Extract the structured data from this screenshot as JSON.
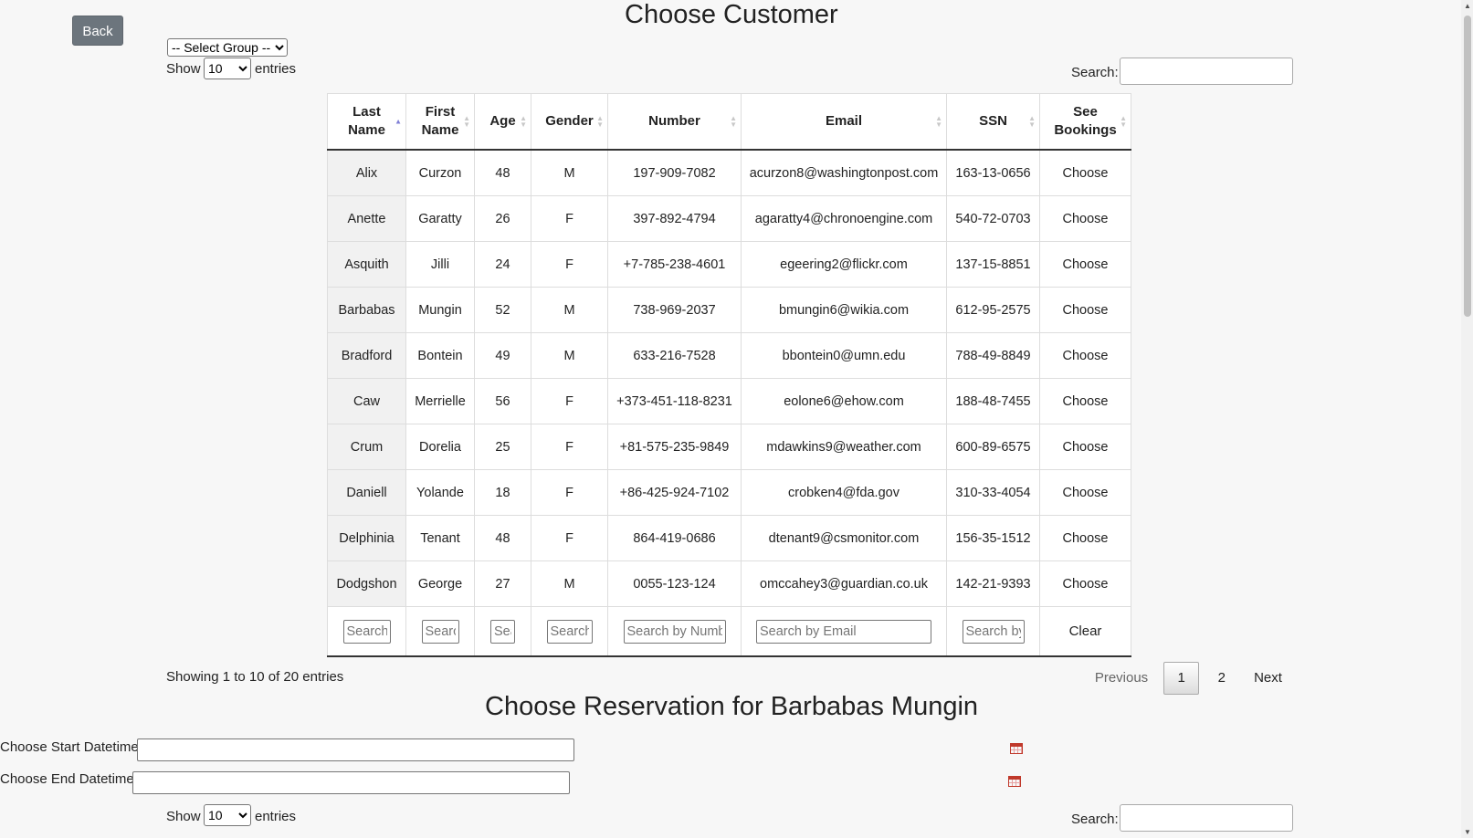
{
  "back_label": "Back",
  "customer_section": {
    "title": "Choose Customer",
    "group_select": "-- Select Group --",
    "show_label": "Show",
    "entries_value": "10",
    "entries_label": "entries",
    "search_label": "Search:"
  },
  "table": {
    "columns": [
      "Last Name",
      "First Name",
      "Age",
      "Gender",
      "Number",
      "Email",
      "SSN",
      "See Bookings"
    ],
    "rows": [
      [
        "Alix",
        "Curzon",
        "48",
        "M",
        "197-909-7082",
        "acurzon8@washingtonpost.com",
        "163-13-0656",
        "Choose"
      ],
      [
        "Anette",
        "Garatty",
        "26",
        "F",
        "397-892-4794",
        "agaratty4@chronoengine.com",
        "540-72-0703",
        "Choose"
      ],
      [
        "Asquith",
        "Jilli",
        "24",
        "F",
        "+7-785-238-4601",
        "egeering2@flickr.com",
        "137-15-8851",
        "Choose"
      ],
      [
        "Barbabas",
        "Mungin",
        "52",
        "M",
        "738-969-2037",
        "bmungin6@wikia.com",
        "612-95-2575",
        "Choose"
      ],
      [
        "Bradford",
        "Bontein",
        "49",
        "M",
        "633-216-7528",
        "bbontein0@umn.edu",
        "788-49-8849",
        "Choose"
      ],
      [
        "Caw",
        "Merrielle",
        "56",
        "F",
        "+373-451-118-8231",
        "eolone6@ehow.com",
        "188-48-7455",
        "Choose"
      ],
      [
        "Crum",
        "Dorelia",
        "25",
        "F",
        "+81-575-235-9849",
        "mdawkins9@weather.com",
        "600-89-6575",
        "Choose"
      ],
      [
        "Daniell",
        "Yolande",
        "18",
        "F",
        "+86-425-924-7102",
        "crobken4@fda.gov",
        "310-33-4054",
        "Choose"
      ],
      [
        "Delphinia",
        "Tenant",
        "48",
        "F",
        "864-419-0686",
        "dtenant9@csmonitor.com",
        "156-35-1512",
        "Choose"
      ],
      [
        "Dodgshon",
        "George",
        "27",
        "M",
        "0055-123-124",
        "omccahey3@guardian.co.uk",
        "142-21-9393",
        "Choose"
      ]
    ],
    "footer_placeholders": [
      "Search by Last Name",
      "Search by First Name",
      "Search by Age",
      "Search by Gender",
      "Search by Number",
      "Search by Email",
      "Search by SSN"
    ],
    "clear_label": "Clear"
  },
  "info": "Showing 1 to 10 of 20 entries",
  "pagination": {
    "previous": "Previous",
    "pages": [
      "1",
      "2"
    ],
    "current": "1",
    "next": "Next"
  },
  "reservation_section": {
    "title": "Choose Reservation for Barbabas Mungin",
    "start_label": "Choose Start Datetime:",
    "end_label": "Choose End Datetime:",
    "show_label": "Show",
    "entries_value": "10",
    "entries_label": "entries",
    "search_label": "Search:"
  }
}
